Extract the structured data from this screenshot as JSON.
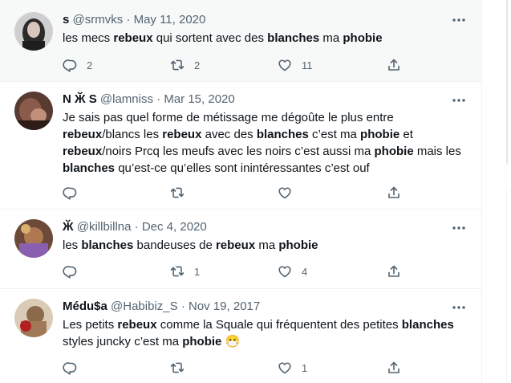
{
  "tweets": [
    {
      "name": "s",
      "handle": "@srmvks",
      "date": "May 11, 2020",
      "text": [
        [
          "les mecs ",
          false
        ],
        [
          "rebeux",
          true
        ],
        [
          " qui sortent avec des ",
          false
        ],
        [
          "blanches",
          true
        ],
        [
          " ma ",
          false
        ],
        [
          "phobie",
          true
        ]
      ],
      "replies": "2",
      "retweets": "2",
      "likes": "11"
    },
    {
      "name": "N Ӂ S",
      "handle": "@lamniss",
      "date": "Mar 15, 2020",
      "text": [
        [
          "Je sais pas quel forme de métissage me dégoûte le plus entre ",
          false
        ],
        [
          "rebeux",
          true
        ],
        [
          "/blancs les ",
          false
        ],
        [
          "rebeux",
          true
        ],
        [
          " avec des ",
          false
        ],
        [
          "blanches",
          true
        ],
        [
          " c’est ma ",
          false
        ],
        [
          "phobie",
          true
        ],
        [
          " et ",
          false
        ],
        [
          "rebeux",
          true
        ],
        [
          "/noirs Prcq les meufs avec les noirs c’est aussi ma ",
          false
        ],
        [
          "phobie",
          true
        ],
        [
          " mais les ",
          false
        ],
        [
          "blanches",
          true
        ],
        [
          " qu’est-ce qu’elles sont inintéressantes c’est ouf",
          false
        ]
      ],
      "replies": "",
      "retweets": "",
      "likes": ""
    },
    {
      "name": "Ӂ",
      "handle": "@killbillna",
      "date": "Dec 4, 2020",
      "text": [
        [
          "les ",
          false
        ],
        [
          "blanches",
          true
        ],
        [
          " bandeuses de ",
          false
        ],
        [
          "rebeux",
          true
        ],
        [
          " ma ",
          false
        ],
        [
          "phobie",
          true
        ]
      ],
      "replies": "",
      "retweets": "1",
      "likes": "4"
    },
    {
      "name": "Médu$a",
      "handle": "@Habibiz_S",
      "date": "Nov 19, 2017",
      "text": [
        [
          "Les petits ",
          false
        ],
        [
          "rebeux",
          true
        ],
        [
          " comme la Squale qui fréquentent des petites ",
          false
        ],
        [
          "blanches",
          true
        ],
        [
          " styles juncky c’est ma ",
          false
        ],
        [
          "phobie",
          true
        ],
        [
          " 😷",
          false
        ]
      ],
      "replies": "",
      "retweets": "",
      "likes": "1"
    }
  ],
  "colors": {
    "accent": "#1d9bf0",
    "muted": "#536471",
    "highlight_bg": "#f7f9f9"
  },
  "icons": [
    "reply-icon",
    "retweet-icon",
    "like-icon",
    "share-icon",
    "more-icon"
  ]
}
